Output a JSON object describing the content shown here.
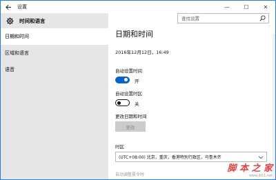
{
  "window": {
    "title": "设置",
    "back_icon": "back-arrow-icon",
    "minimize_glyph": "—",
    "maximize_glyph": "☐",
    "close_glyph": "✕"
  },
  "sidebar": {
    "header_label": "时间和语言",
    "header_icon": "gear-icon",
    "items": [
      {
        "label": "日期和时间",
        "active": true
      },
      {
        "label": "区域和语言",
        "active": false
      },
      {
        "label": "语音",
        "active": false
      }
    ]
  },
  "search": {
    "placeholder": "查找设置"
  },
  "main": {
    "title": "日期和时间",
    "current_datetime": "2016年12月12日，16:49",
    "auto_time": {
      "label": "自动设置时间",
      "state": "开",
      "on": true
    },
    "auto_timezone": {
      "label": "自动设置时区",
      "state": "关",
      "on": false
    },
    "change_datetime": {
      "label": "更改日期和时间",
      "button_label": "更改"
    },
    "timezone": {
      "label": "时区",
      "value": "(UTC+08:00) 北京，重庆，香港特别行政区，乌鲁木齐"
    },
    "dst_label": "自动调整夏令时"
  },
  "watermark": {
    "text": "脚 本 之 家",
    "url": "www.jb51.net"
  },
  "colors": {
    "accent": "#0a63c9",
    "sidebar_bg": "#e6e6e6",
    "window_border": "#2b79d6"
  }
}
